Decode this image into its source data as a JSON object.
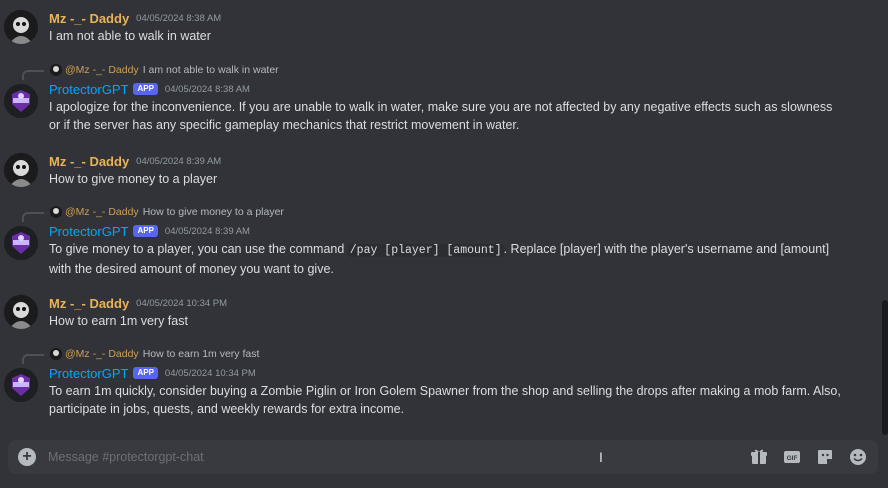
{
  "channel": {
    "placeholder": "Message #protectorgpt-chat"
  },
  "messages": [
    {
      "author": "Mz -_- Daddy",
      "timestamp": "04/05/2024 8:38 AM",
      "text": "I am not able to walk in water"
    },
    {
      "reply": {
        "name": "@Mz -_- Daddy",
        "text": "I am not able to walk in water"
      },
      "author": "ProtectorGPT",
      "badge": "APP",
      "timestamp": "04/05/2024 8:38 AM",
      "line1": "I apologize for the inconvenience. If you are unable to walk in water, make sure you are not affected by any negative effects such as slowness",
      "line2": "or if the server has any specific gameplay mechanics that restrict movement in water."
    },
    {
      "author": "Mz -_- Daddy",
      "timestamp": "04/05/2024 8:39 AM",
      "text": "How to give money to a player"
    },
    {
      "reply": {
        "name": "@Mz -_- Daddy",
        "text": "How to give money to a player"
      },
      "author": "ProtectorGPT",
      "badge": "APP",
      "timestamp": "04/05/2024 8:39 AM",
      "pre": "To give money to a player, you can use the command ",
      "code": "/pay [player] [amount]",
      "post": ". Replace [player] with the player's username and [amount]",
      "line2": "with the desired amount of money you want to give."
    },
    {
      "author": "Mz -_- Daddy",
      "timestamp": "04/05/2024 10:34 PM",
      "text": "How to earn 1m very fast"
    },
    {
      "reply": {
        "name": "@Mz -_- Daddy",
        "text": "How to earn 1m very fast"
      },
      "author": "ProtectorGPT",
      "badge": "APP",
      "timestamp": "04/05/2024 10:34 PM",
      "line1": "To earn 1m quickly, consider buying a Zombie Piglin or Iron Golem Spawner from the shop and selling the drops after making a mob farm. Also,",
      "line2": "participate in jobs, quests, and weekly rewards for extra income."
    }
  ],
  "toolbar": {
    "gif_label": "GIF",
    "icons": [
      "gift-icon",
      "gif-icon",
      "sticker-icon",
      "emoji-icon"
    ]
  },
  "colors": {
    "user_name": "#e8b35a",
    "bot_name": "#00a8fc",
    "badge": "#5865f2",
    "background": "#313338"
  }
}
